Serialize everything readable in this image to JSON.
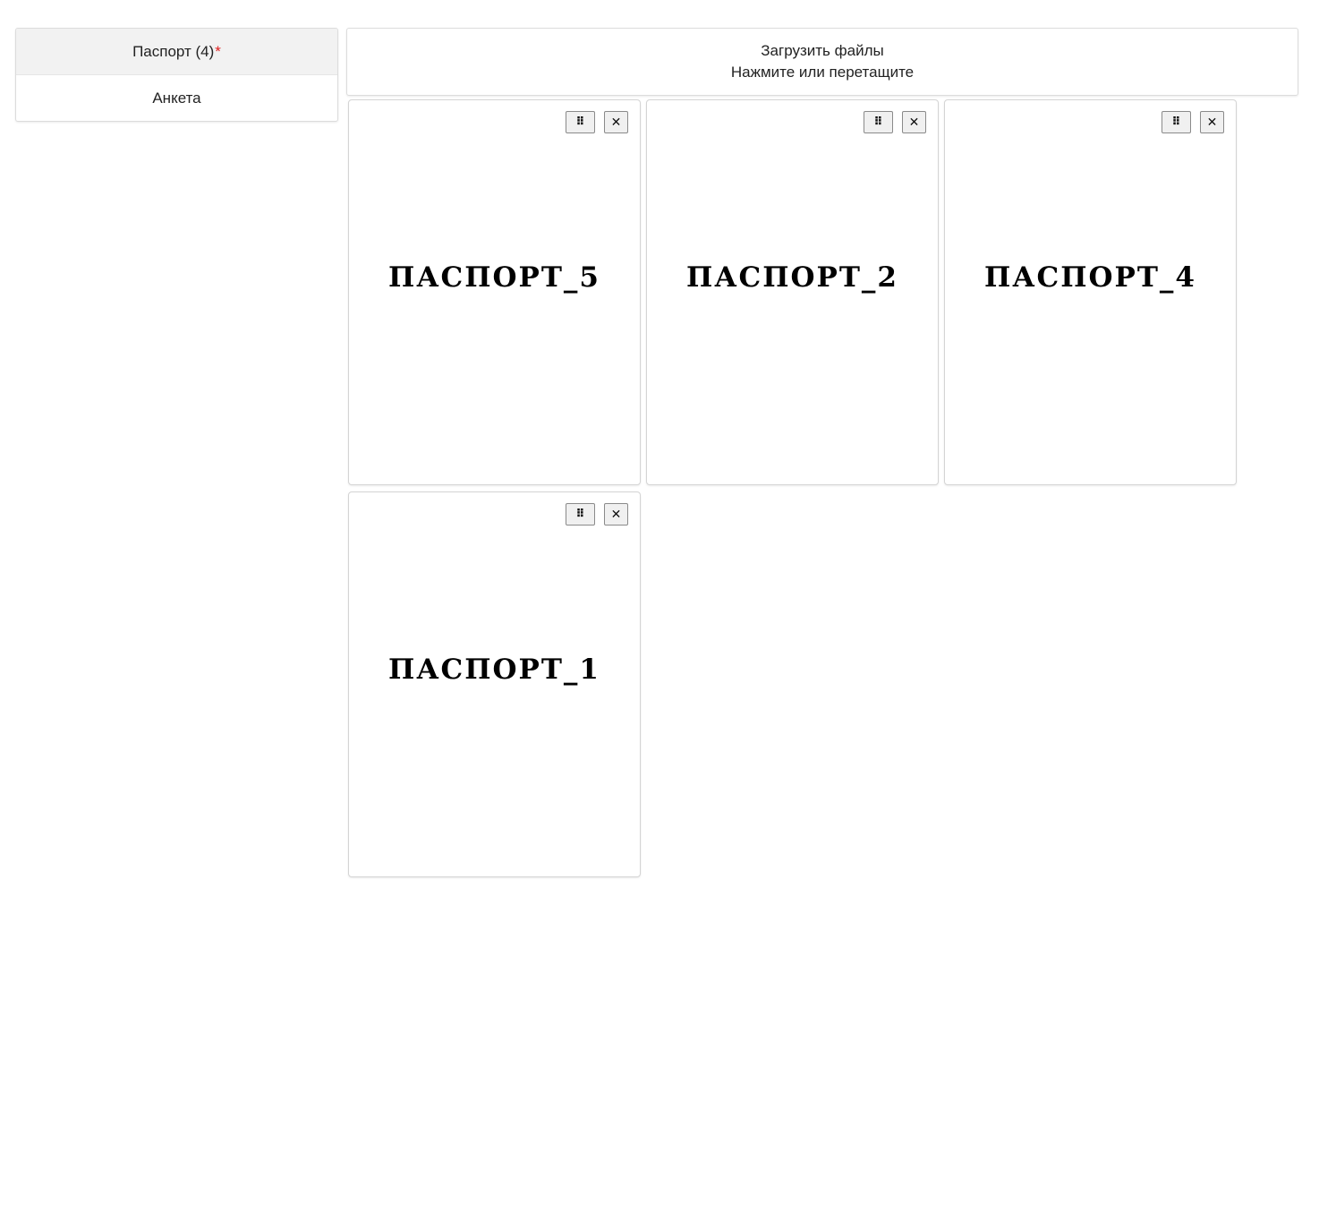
{
  "sidebar": {
    "items": [
      {
        "label": "Паспорт (4)",
        "required_mark": "*",
        "active": true
      },
      {
        "label": "Анкета",
        "active": false
      }
    ]
  },
  "upload": {
    "title": "Загрузить файлы",
    "hint": "Нажмите или перетащите"
  },
  "cards": [
    {
      "label": "ПАСПОРТ_5",
      "drag_icon": "drag-handle-icon",
      "close_icon": "close-icon",
      "drag_glyph": "⠿",
      "close_glyph": "✕"
    },
    {
      "label": "ПАСПОРТ_2",
      "drag_icon": "drag-handle-icon",
      "close_icon": "close-icon",
      "drag_glyph": "⠿",
      "close_glyph": "✕"
    },
    {
      "label": "ПАСПОРТ_4",
      "drag_icon": "drag-handle-icon",
      "close_icon": "close-icon",
      "drag_glyph": "⠿",
      "close_glyph": "✕"
    },
    {
      "label": "ПАСПОРТ_1",
      "drag_icon": "drag-handle-icon",
      "close_icon": "close-icon",
      "drag_glyph": "⠿",
      "close_glyph": "✕"
    }
  ],
  "colors": {
    "required": "#e02020",
    "active_bg": "#f2f2f2",
    "border": "#dcdcdc"
  }
}
